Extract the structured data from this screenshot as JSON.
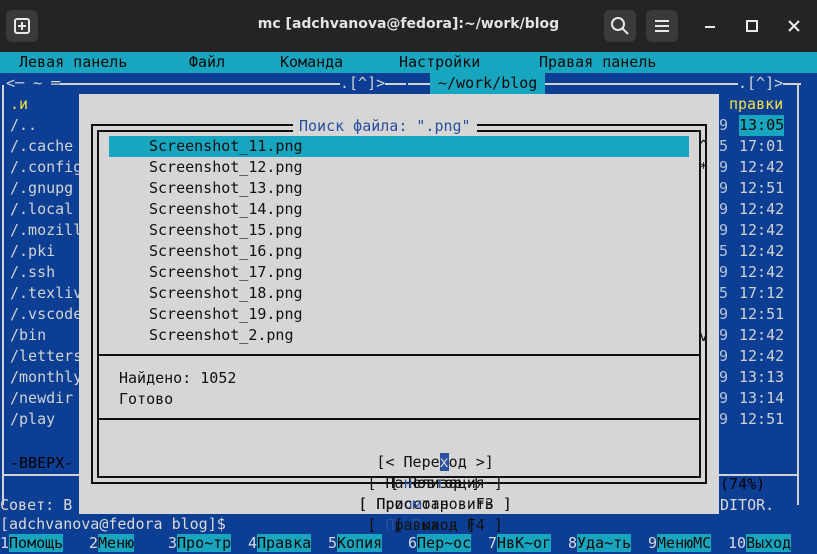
{
  "window": {
    "title": "mc [adchvanova@fedora]:~/work/blog",
    "minimize_glyph": "–",
    "maximize_glyph": "□",
    "close_glyph": "✕"
  },
  "menubar": {
    "items": [
      "Левая панель",
      "Файл",
      "Команда",
      "Настройки",
      "Правая панель"
    ]
  },
  "left_panel": {
    "top_left": "<─ ~ ═",
    "top_right": ".[^]>",
    "column_header": ".и",
    "items": [
      "/..",
      "/.cache",
      "/.config",
      "/.gnupg",
      "/.local",
      "/.mozilla",
      "/.pki",
      "/.ssh",
      "/.texlive",
      "/.vscode",
      "/bin",
      "/letters",
      "/monthly",
      "/newdir",
      "/play"
    ],
    "bottom": "-ВВЕРХ-"
  },
  "right_panel": {
    "path": "~/work/blog",
    "top_right": ".[^]>",
    "column_header": "правки",
    "times": [
      "13:05",
      "17:01",
      "12:42",
      "12:51",
      "12:42",
      "12:42",
      "12:42",
      "12:42",
      "17:12",
      "12:51",
      "12:42",
      "12:42",
      "13:13",
      "13:14",
      "12:51"
    ],
    "left_digits": [
      "9",
      "5",
      "9",
      "9",
      "9",
      "9",
      "5",
      "9",
      "5",
      "9",
      "9",
      "9",
      "9",
      "9",
      "9"
    ],
    "percent": "(74%)"
  },
  "hint": {
    "left": "Совет: В",
    "right": "DITOR."
  },
  "prompt": {
    "user": "[adchvanova@fedora blog]$"
  },
  "dialog": {
    "title": "Поиск файла: \".png\"",
    "files": [
      "Screenshot_11.png",
      "Screenshot_12.png",
      "Screenshot_13.png",
      "Screenshot_14.png",
      "Screenshot_15.png",
      "Screenshot_16.png",
      "Screenshot_17.png",
      "Screenshot_18.png",
      "Screenshot_19.png",
      "Screenshot_2.png"
    ],
    "scroll_up": "^",
    "scroll_mark": "*",
    "scroll_down": "v",
    "found": "Найдено: 1052",
    "status": "Готово",
    "buttons": {
      "goto": {
        "pre": "[< Пере",
        "cursor": "х",
        "post": "од >]"
      },
      "repeat": {
        "pre": "[ Пов",
        "hot": "т",
        "post": "ор ]"
      },
      "suspend": {
        "pre": "[ При",
        "hot": "о",
        "post": "становить ]"
      },
      "quit": {
        "pre": "[ ",
        "hot": "В",
        "post": "ыход ]"
      },
      "panelize": {
        "pre": "[ Па",
        "hot": "н",
        "post": "елизация ]"
      },
      "view": {
        "pre": "[ Прос",
        "hot": "м",
        "post": "отр - F3 ]"
      },
      "edit": {
        "pre": "[ ",
        "hot": "П",
        "post": "равка - F4 ]"
      }
    }
  },
  "fkeys": [
    {
      "num": "1",
      "label": "Помощь"
    },
    {
      "num": "2",
      "label": "Меню"
    },
    {
      "num": "3",
      "label": "Про~тр"
    },
    {
      "num": "4",
      "label": "Правка"
    },
    {
      "num": "5",
      "label": "Копия"
    },
    {
      "num": "6",
      "label": "Пер~ос"
    },
    {
      "num": "7",
      "label": "НвК~ог"
    },
    {
      "num": "8",
      "label": "Уда~ть"
    },
    {
      "num": "9",
      "label": "МенюMC"
    },
    {
      "num": "10",
      "label": "Выход"
    }
  ]
}
